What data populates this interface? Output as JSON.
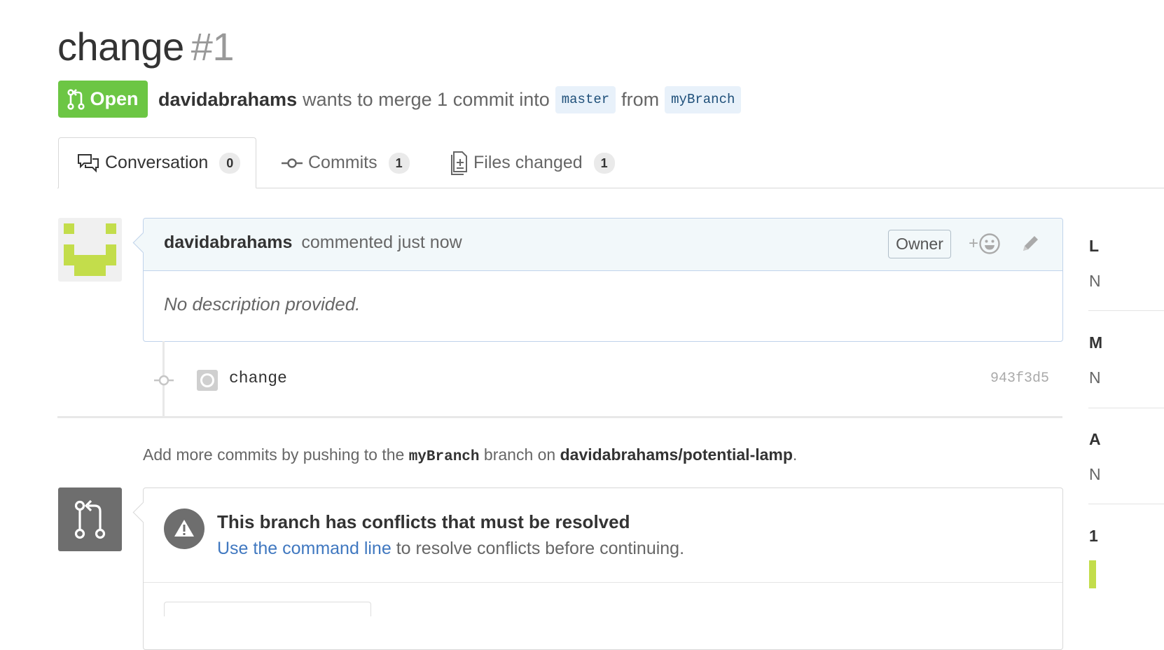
{
  "pr": {
    "title": "change",
    "number": "#1",
    "state": "Open",
    "author": "davidabrahams",
    "merge_text_before": "wants to merge 1 commit into",
    "base_branch": "master",
    "from_text": "from",
    "head_branch": "myBranch"
  },
  "tabs": [
    {
      "label": "Conversation",
      "count": "0",
      "icon": "conversation-icon"
    },
    {
      "label": "Commits",
      "count": "1",
      "icon": "commit-icon"
    },
    {
      "label": "Files changed",
      "count": "1",
      "icon": "file-diff-icon"
    }
  ],
  "comment": {
    "author": "davidabrahams",
    "meta": "commented just now",
    "owner_label": "Owner",
    "reaction_plus": "+",
    "body": "No description provided."
  },
  "commit": {
    "message": "change",
    "sha": "943f3d5"
  },
  "push_hint": {
    "before": "Add more commits by pushing to the",
    "branch": "myBranch",
    "middle": "branch on",
    "repo": "davidabrahams/potential-lamp",
    "end": "."
  },
  "merge": {
    "title": "This branch has conflicts that must be resolved",
    "link_text": "Use the command line",
    "after_link": "to resolve conflicts before continuing."
  },
  "sidebar": {
    "letters": [
      "L",
      "N",
      "M",
      "N",
      "A",
      "N",
      "1"
    ]
  },
  "colors": {
    "open_green": "#6cc644",
    "link_blue": "#4078c0",
    "branch_bg": "#e8f1fa",
    "avatar_green": "#c3dd4b"
  }
}
